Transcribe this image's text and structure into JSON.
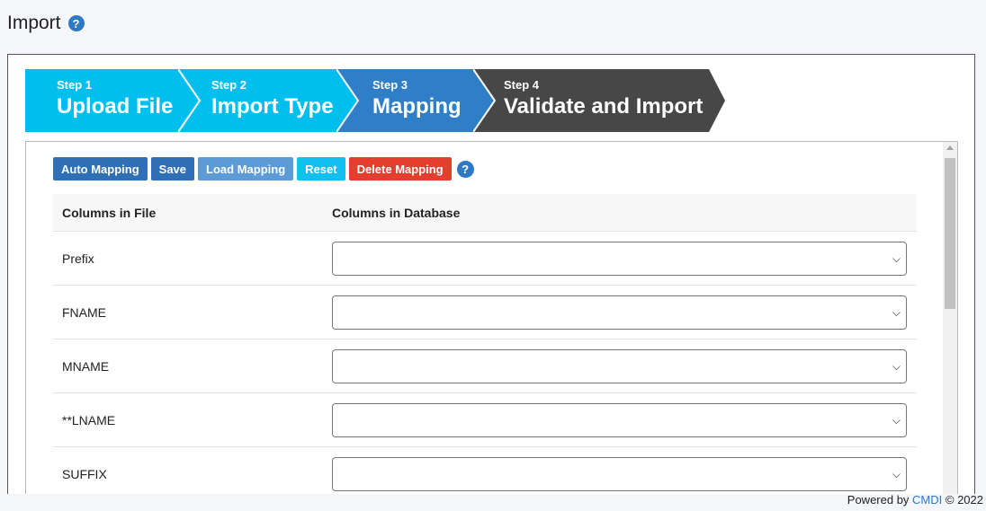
{
  "header": {
    "title": "Import",
    "help_icon": "?"
  },
  "wizard": {
    "steps": [
      {
        "number": "Step 1",
        "name": "Upload File",
        "color": "#00bfef"
      },
      {
        "number": "Step 2",
        "name": "Import Type",
        "color": "#00bfef"
      },
      {
        "number": "Step 3",
        "name": "Mapping",
        "color": "#2f7fc8"
      },
      {
        "number": "Step 4",
        "name": "Validate and Import",
        "color": "#474747"
      }
    ]
  },
  "toolbar": {
    "auto_mapping": "Auto Mapping",
    "save": "Save",
    "load_mapping": "Load Mapping",
    "reset": "Reset",
    "delete_mapping": "Delete Mapping",
    "help_icon": "?"
  },
  "table": {
    "headers": [
      "Columns in File",
      "Columns in Database"
    ],
    "rows": [
      {
        "file_column": "Prefix",
        "db_column": ""
      },
      {
        "file_column": "FNAME",
        "db_column": ""
      },
      {
        "file_column": "MNAME",
        "db_column": ""
      },
      {
        "file_column": "**LNAME",
        "db_column": ""
      },
      {
        "file_column": "SUFFIX",
        "db_column": ""
      }
    ]
  },
  "footer": {
    "prefix": "Powered by ",
    "brand": "CMDI",
    "suffix": " © 2022"
  }
}
